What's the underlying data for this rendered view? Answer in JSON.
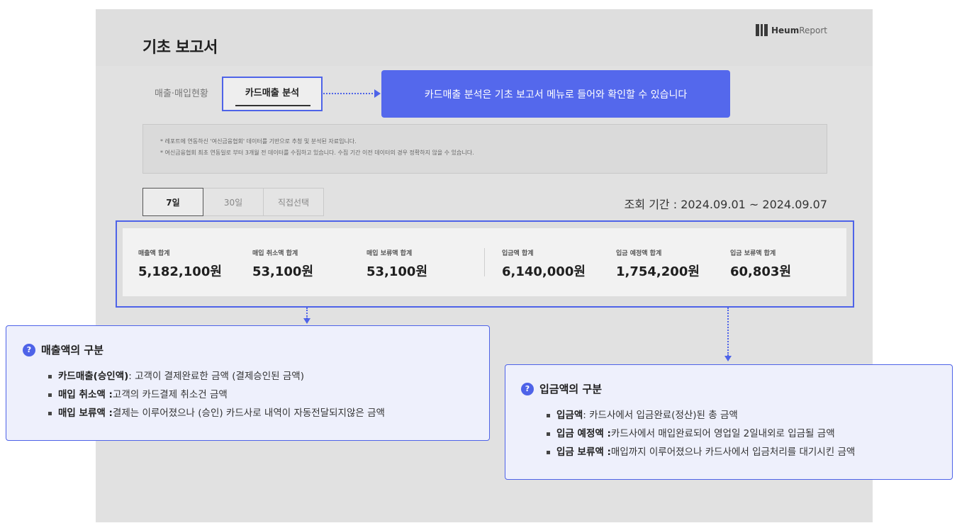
{
  "header": {
    "title": "기초 보고서",
    "brand_strong": "Heum",
    "brand_light": "Report",
    "brand_icon": "heum-logo-icon"
  },
  "tabs": [
    {
      "label": "매출·매입현황",
      "active": false
    },
    {
      "label": "카드매출 분석",
      "active": true
    }
  ],
  "callout_top": "카드매출 분석은 기초 보고서 메뉴로 들어와 확인할 수 있습니다",
  "notice": [
    "* 레포트에 연동하신 '여신금융협회' 데이터를 기반으로 추청 및 분석된 자료입니다.",
    "* 여신금융협회 최초 연동일로 부터 3개월 전 데이터를 수집하고 있습니다. 수집 기간 이전 데이터의 경우 정확하지 않을 수 있습니다."
  ],
  "period_buttons": [
    {
      "label": "7일",
      "active": true
    },
    {
      "label": "30일",
      "active": false
    },
    {
      "label": "직접선택",
      "active": false
    }
  ],
  "query_period": "조회 기간 : 2024.09.01 ~ 2024.09.07",
  "summary": [
    {
      "label": "매출액 합계",
      "value": "5,182,100원"
    },
    {
      "label": "매입 취소액 합계",
      "value": "53,100원"
    },
    {
      "label": "매입 보류액 합계",
      "value": "53,100원"
    },
    {
      "label": "입금액 합계",
      "value": "6,140,000원"
    },
    {
      "label": "입금 예정액 합계",
      "value": "1,754,200원"
    },
    {
      "label": "입금 보류액 합계",
      "value": "60,803원"
    }
  ],
  "info_sales": {
    "title": "매출액의 구분",
    "icon": "question-icon",
    "items": [
      {
        "term": "카드매출(승인액)",
        "desc": " : 고객이 결제완료한 금액 (결제승인된 금액)"
      },
      {
        "term": "매입 취소액 :",
        "desc": " 고객의 카드결제 취소건 금액"
      },
      {
        "term": "매입 보류액 :",
        "desc": " 결제는 이루어졌으나 (승인) 카드사로 내역이 자동전달되지않은 금액"
      }
    ]
  },
  "info_deposit": {
    "title": "입금액의 구분",
    "icon": "question-icon",
    "items": [
      {
        "term": "입금액",
        "desc": " : 카드사에서 입금완료(정산)된 총 금액"
      },
      {
        "term": "입금 예정액 :",
        "desc": " 카드사에서 매입완료되어 영업일 2일내외로 입금될 금액"
      },
      {
        "term": "입금 보류액 :",
        "desc": " 매입까지 이루어졌으나 카드사에서 입금처리를 대기시킨 금액"
      }
    ]
  },
  "colors": {
    "accent": "#4e63e8",
    "callout_bg": "#5468ec",
    "panel_bg": "#e1e1e1",
    "info_bg": "#eef0fc"
  }
}
